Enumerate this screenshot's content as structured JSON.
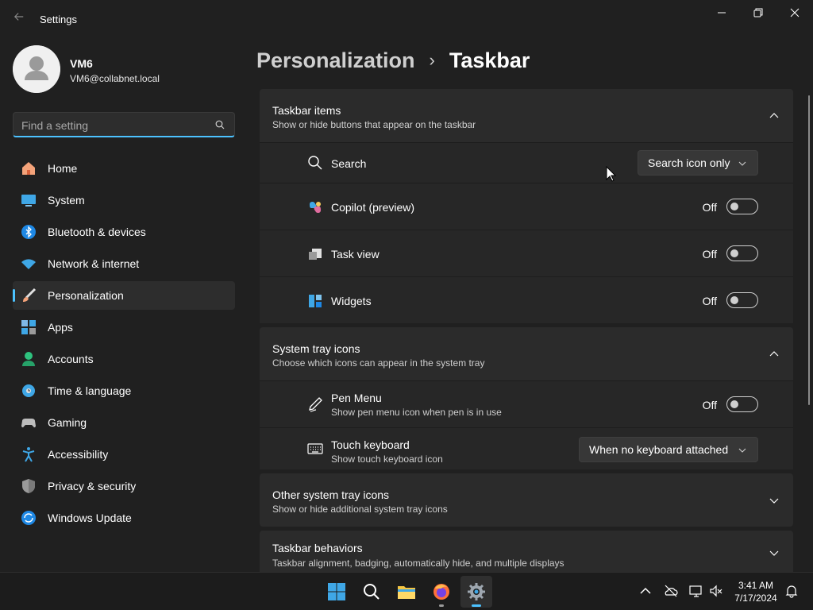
{
  "window": {
    "title": "Settings"
  },
  "user": {
    "name": "VM6",
    "email": "VM6@collabnet.local"
  },
  "search": {
    "placeholder": "Find a setting"
  },
  "nav": [
    {
      "label": "Home",
      "icon": "home-icon"
    },
    {
      "label": "System",
      "icon": "system-icon"
    },
    {
      "label": "Bluetooth & devices",
      "icon": "bluetooth-icon"
    },
    {
      "label": "Network & internet",
      "icon": "wifi-icon"
    },
    {
      "label": "Personalization",
      "icon": "brush-icon"
    },
    {
      "label": "Apps",
      "icon": "apps-icon"
    },
    {
      "label": "Accounts",
      "icon": "accounts-icon"
    },
    {
      "label": "Time & language",
      "icon": "globe-icon"
    },
    {
      "label": "Gaming",
      "icon": "controller-icon"
    },
    {
      "label": "Accessibility",
      "icon": "accessibility-icon"
    },
    {
      "label": "Privacy & security",
      "icon": "shield-icon"
    },
    {
      "label": "Windows Update",
      "icon": "update-icon"
    }
  ],
  "active_nav": "Personalization",
  "breadcrumb": {
    "parent": "Personalization",
    "separator": "›",
    "current": "Taskbar"
  },
  "sections": {
    "taskbar_items": {
      "title": "Taskbar items",
      "subtitle": "Show or hide buttons that appear on the taskbar",
      "search": {
        "label": "Search",
        "value": "Search icon only"
      },
      "copilot": {
        "label": "Copilot (preview)",
        "state": "Off"
      },
      "task_view": {
        "label": "Task view",
        "state": "Off"
      },
      "widgets": {
        "label": "Widgets",
        "state": "Off"
      }
    },
    "system_tray": {
      "title": "System tray icons",
      "subtitle": "Choose which icons can appear in the system tray",
      "pen_menu": {
        "label": "Pen Menu",
        "sub": "Show pen menu icon when pen is in use",
        "state": "Off"
      },
      "touch_keyboard": {
        "label": "Touch keyboard",
        "sub": "Show touch keyboard icon",
        "value": "When no keyboard attached"
      }
    },
    "other_tray": {
      "title": "Other system tray icons",
      "subtitle": "Show or hide additional system tray icons"
    },
    "behaviors": {
      "title": "Taskbar behaviors",
      "subtitle": "Taskbar alignment, badging, automatically hide, and multiple displays"
    }
  },
  "taskbar": {
    "apps": [
      "start-icon",
      "search-icon",
      "file-explorer-icon",
      "firefox-icon",
      "settings-icon"
    ],
    "time": "3:41 AM",
    "date": "7/17/2024"
  },
  "colors": {
    "accent": "#4cc2ff",
    "background": "#202020",
    "card": "#2b2b2b"
  }
}
